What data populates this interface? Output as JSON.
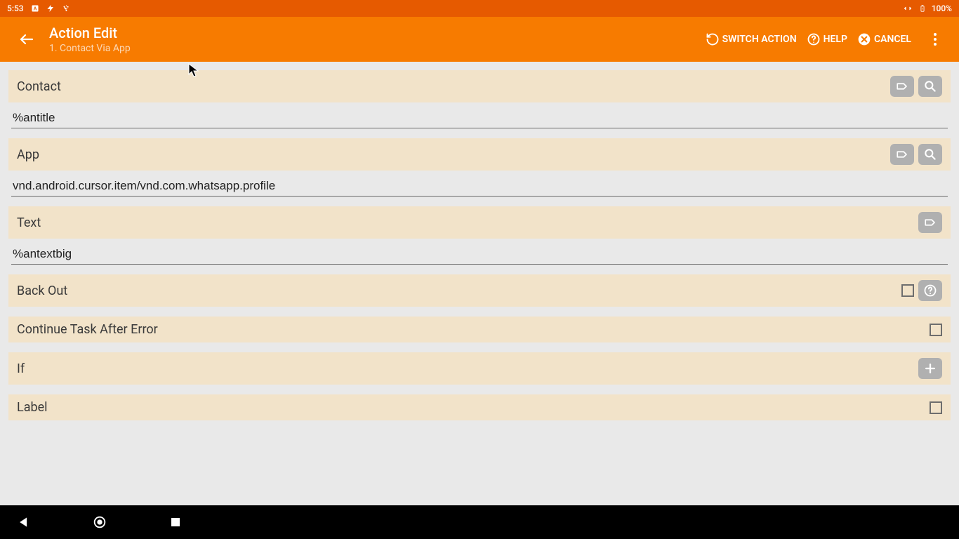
{
  "status": {
    "time": "5:53",
    "battery": "100%"
  },
  "header": {
    "title": "Action Edit",
    "subtitle": "1. Contact Via App",
    "switch_label": "SWITCH ACTION",
    "help_label": "HELP",
    "cancel_label": "CANCEL"
  },
  "fields": {
    "contact": {
      "label": "Contact",
      "value": "%antitle"
    },
    "app": {
      "label": "App",
      "value": "vnd.android.cursor.item/vnd.com.whatsapp.profile"
    },
    "text": {
      "label": "Text",
      "value": "%antextbig"
    },
    "backout": {
      "label": "Back Out"
    },
    "continue": {
      "label": "Continue Task After Error"
    },
    "if": {
      "label": "If"
    },
    "label": {
      "label": "Label"
    }
  }
}
